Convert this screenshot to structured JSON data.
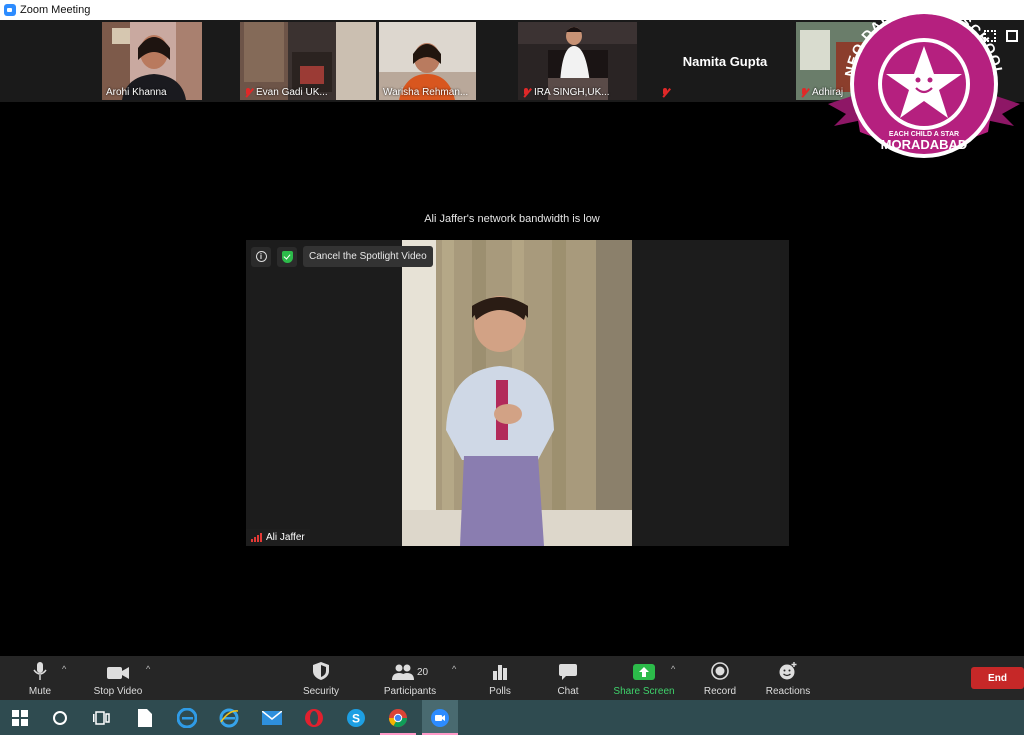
{
  "window": {
    "title": "Zoom Meeting"
  },
  "participants_strip": [
    {
      "name": "Arohi Khanna",
      "muted": false
    },
    {
      "name": "Evan Gadi UK...",
      "muted": true
    },
    {
      "name": "Warisha Rehman...",
      "muted": false
    },
    {
      "name": "IRA SINGH,UK...",
      "muted": true
    },
    {
      "name": "Namita Gupta",
      "muted": true
    },
    {
      "name": "Adhiraj",
      "muted": true
    }
  ],
  "status_message": "Ali Jaffer's network bandwidth is low",
  "spotlight": {
    "cancel_label": "Cancel the Spotlight Video",
    "participant_name": "Ali Jaffer"
  },
  "toolbar": {
    "mute_label": "Mute",
    "stop_video_label": "Stop Video",
    "security_label": "Security",
    "participants_label": "Participants",
    "participants_count": "20",
    "polls_label": "Polls",
    "chat_label": "Chat",
    "share_screen_label": "Share Screen",
    "record_label": "Record",
    "reactions_label": "Reactions",
    "end_label": "End"
  },
  "school_logo": {
    "name_top": "NEO DALES PLAY SCHOOL",
    "tagline": "EACH CHILD A STAR",
    "city": "MORADABAD"
  },
  "colors": {
    "accent_green": "#3fd26b",
    "end_red": "#c62828",
    "logo_magenta": "#b5207f",
    "taskbar": "#2f4b50"
  }
}
